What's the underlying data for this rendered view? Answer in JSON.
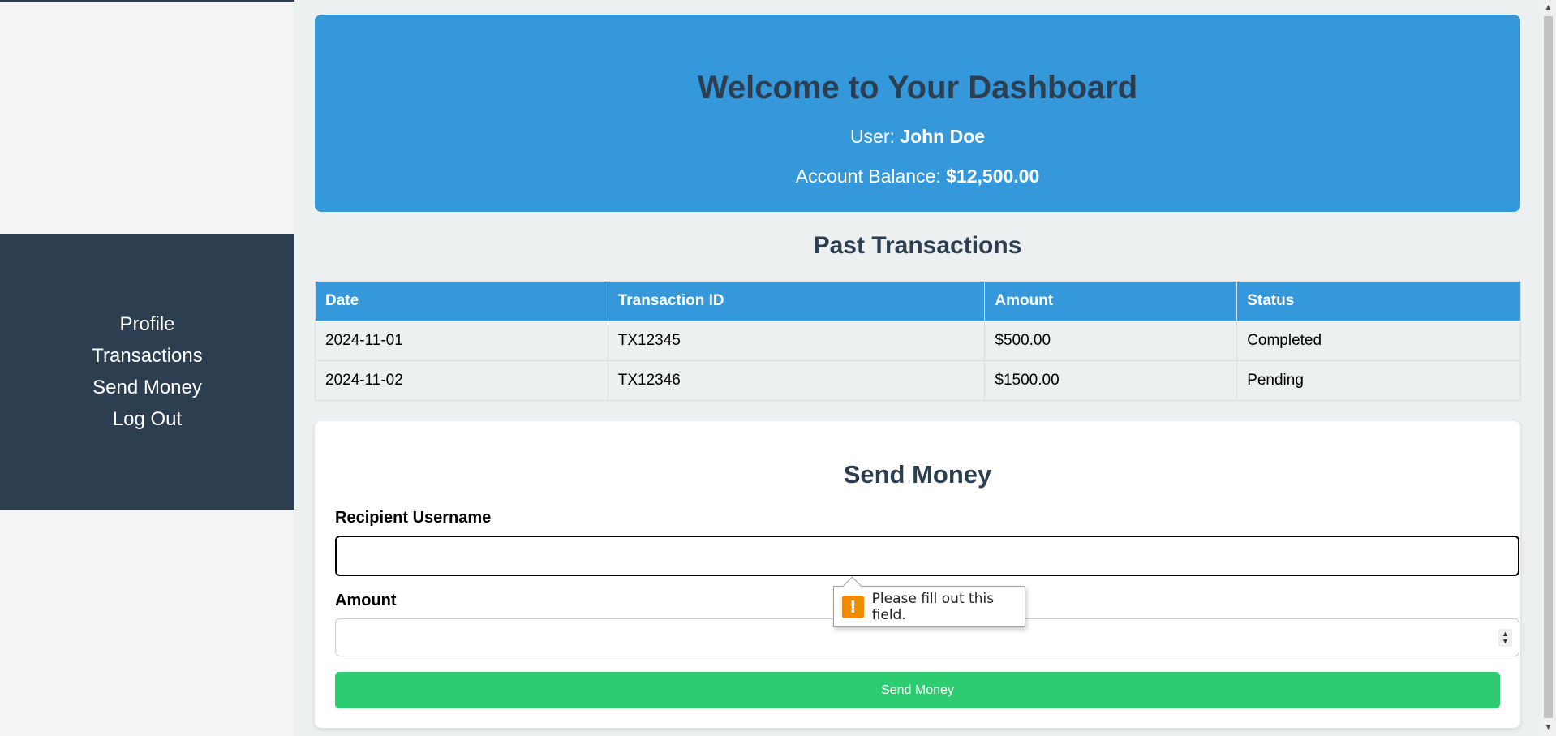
{
  "sidebar": {
    "items": [
      {
        "label": "Profile"
      },
      {
        "label": "Transactions"
      },
      {
        "label": "Send Money"
      },
      {
        "label": "Log Out"
      }
    ]
  },
  "header": {
    "title": "Welcome to Your Dashboard",
    "user_prefix": "User:",
    "user_name": "John Doe",
    "balance_prefix": "Account Balance:",
    "balance_value": "$12,500.00"
  },
  "transactions": {
    "title": "Past Transactions",
    "columns": [
      "Date",
      "Transaction ID",
      "Amount",
      "Status"
    ],
    "rows": [
      [
        "2024-11-01",
        "TX12345",
        "$500.00",
        "Completed"
      ],
      [
        "2024-11-02",
        "TX12346",
        "$1500.00",
        "Pending"
      ]
    ]
  },
  "send_money": {
    "title": "Send Money",
    "recipient_label": "Recipient Username",
    "recipient_value": "",
    "amount_label": "Amount",
    "amount_value": "",
    "button_label": "Send Money"
  },
  "validation_tooltip": {
    "icon": "warning-icon",
    "message": "Please fill out this field."
  },
  "colors": {
    "sidebar_bg": "#2c3e50",
    "header_bg": "#3498db",
    "button_bg": "#2ecc71",
    "warning": "#f28a00"
  }
}
